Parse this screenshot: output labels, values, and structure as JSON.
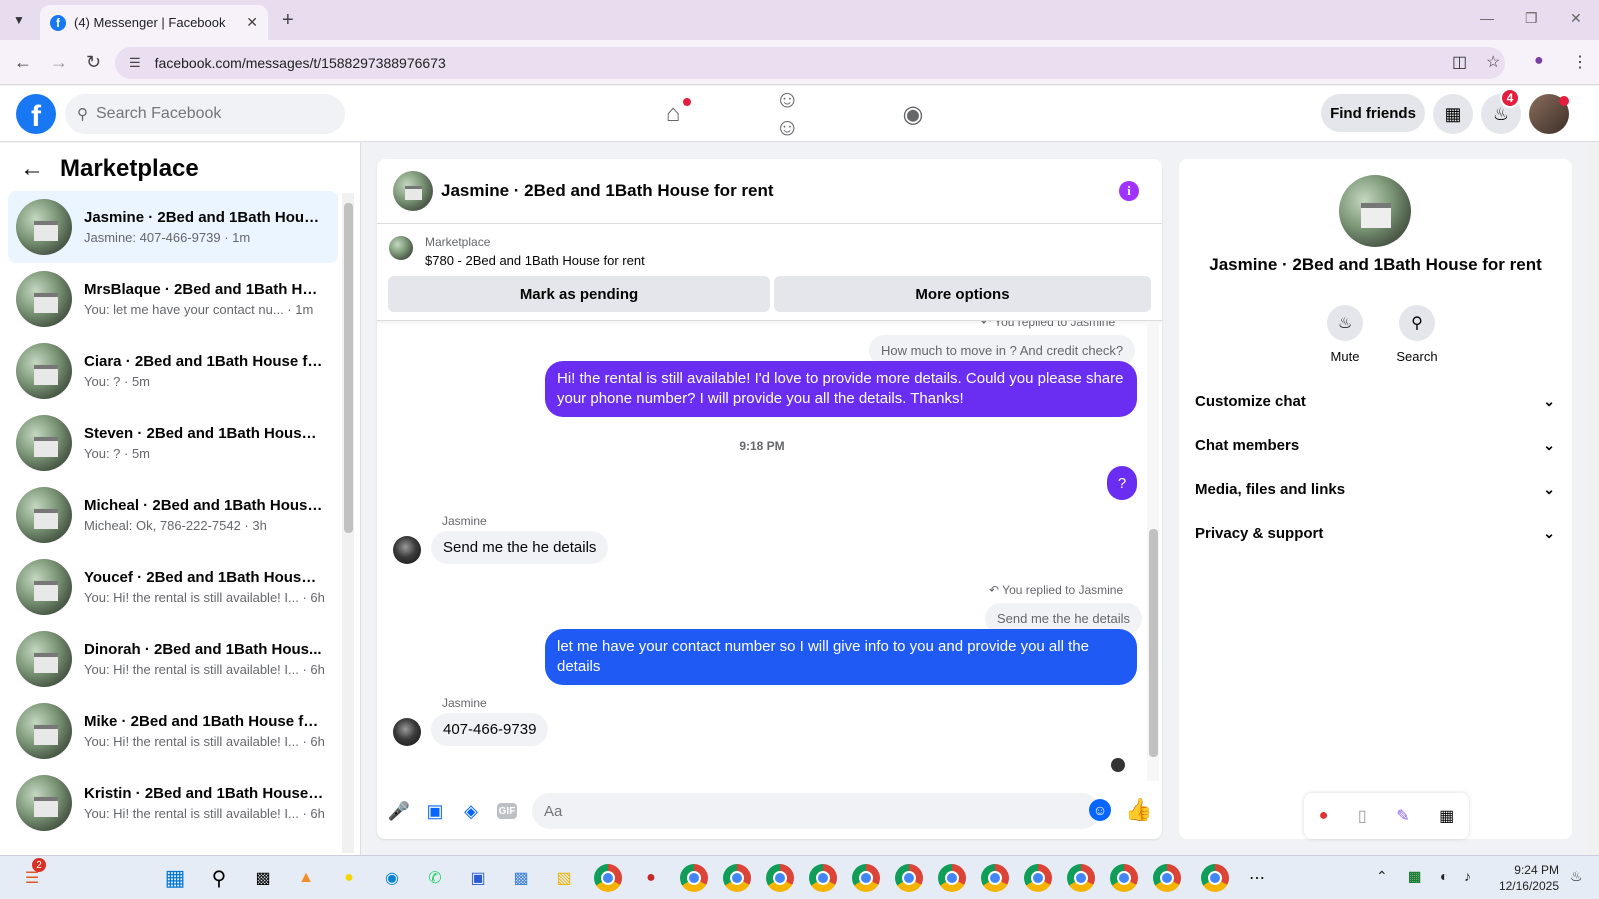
{
  "browser": {
    "tab_title": "(4) Messenger | Facebook",
    "url": "facebook.com/messages/t/1588297388976673"
  },
  "fb_header": {
    "search_placeholder": "Search Facebook",
    "find_friends_label": "Find friends",
    "notification_count": "4"
  },
  "left_panel": {
    "title": "Marketplace",
    "conversations": [
      {
        "name": "Jasmine · 2Bed and 1Bath House...",
        "snippet": "Jasmine: 407-466-9739 · 1m",
        "active": true
      },
      {
        "name": "MrsBlaque · 2Bed and 1Bath Ho...",
        "snippet": "You: let me have your contact nu... · 1m"
      },
      {
        "name": "Ciara · 2Bed and 1Bath House fo...",
        "snippet": "You: ? · 5m"
      },
      {
        "name": "Steven · 2Bed and 1Bath House ...",
        "snippet": "You: ? · 5m"
      },
      {
        "name": "Micheal · 2Bed and 1Bath House...",
        "snippet": "Micheal: Ok, 786-222-7542 · 3h"
      },
      {
        "name": "Youcef · 2Bed and 1Bath House ...",
        "snippet": "You: Hi! the rental is still available! I... · 6h"
      },
      {
        "name": "Dinorah · 2Bed and 1Bath Hous...",
        "snippet": "You: Hi! the rental is still available! I... · 6h"
      },
      {
        "name": "Mike · 2Bed and 1Bath House fo...",
        "snippet": "You: Hi! the rental is still available! I... · 6h"
      },
      {
        "name": "Kristin · 2Bed and 1Bath House f...",
        "snippet": "You: Hi! the rental is still available! I... · 6h"
      }
    ]
  },
  "chat": {
    "title": "Jasmine · 2Bed and 1Bath House for rent",
    "marketplace_label": "Marketplace",
    "listing": "$780 - 2Bed and 1Bath House for rent",
    "mark_pending_label": "Mark as pending",
    "more_options_label": "More options",
    "messages": {
      "reply_note_1": "You replied to Jasmine",
      "quoted_1": "How much to move in ? And credit check?",
      "out_1": "Hi! the rental is still available! I'd love to provide more details. Could you please share your phone number? I will provide you all the details. Thanks!",
      "timestamp": "9:18 PM",
      "out_2": "?",
      "sender_1": "Jasmine",
      "in_1": "Send me the he details",
      "reply_note_2": "You replied to Jasmine",
      "quoted_2": "Send me the he details",
      "out_3": "let me have your contact number so I will give info to you and provide you all the details",
      "sender_2": "Jasmine",
      "in_2": "407-466-9739"
    },
    "composer_placeholder": "Aa",
    "gif_label": "GIF"
  },
  "right_panel": {
    "name": "Jasmine · 2Bed and 1Bath House for rent",
    "mute_label": "Mute",
    "search_label": "Search",
    "sections": [
      "Customize chat",
      "Chat members",
      "Media, files and links",
      "Privacy & support"
    ]
  },
  "taskbar": {
    "time": "9:24 PM",
    "date": "12/16/2025",
    "app_badge": "2"
  },
  "colors": {
    "fb_blue": "#1877f2",
    "outgoing_purple": "#6a2ef2",
    "outgoing_blue": "#1f5af5",
    "active_conversation_bg": "#ebf5ff"
  }
}
